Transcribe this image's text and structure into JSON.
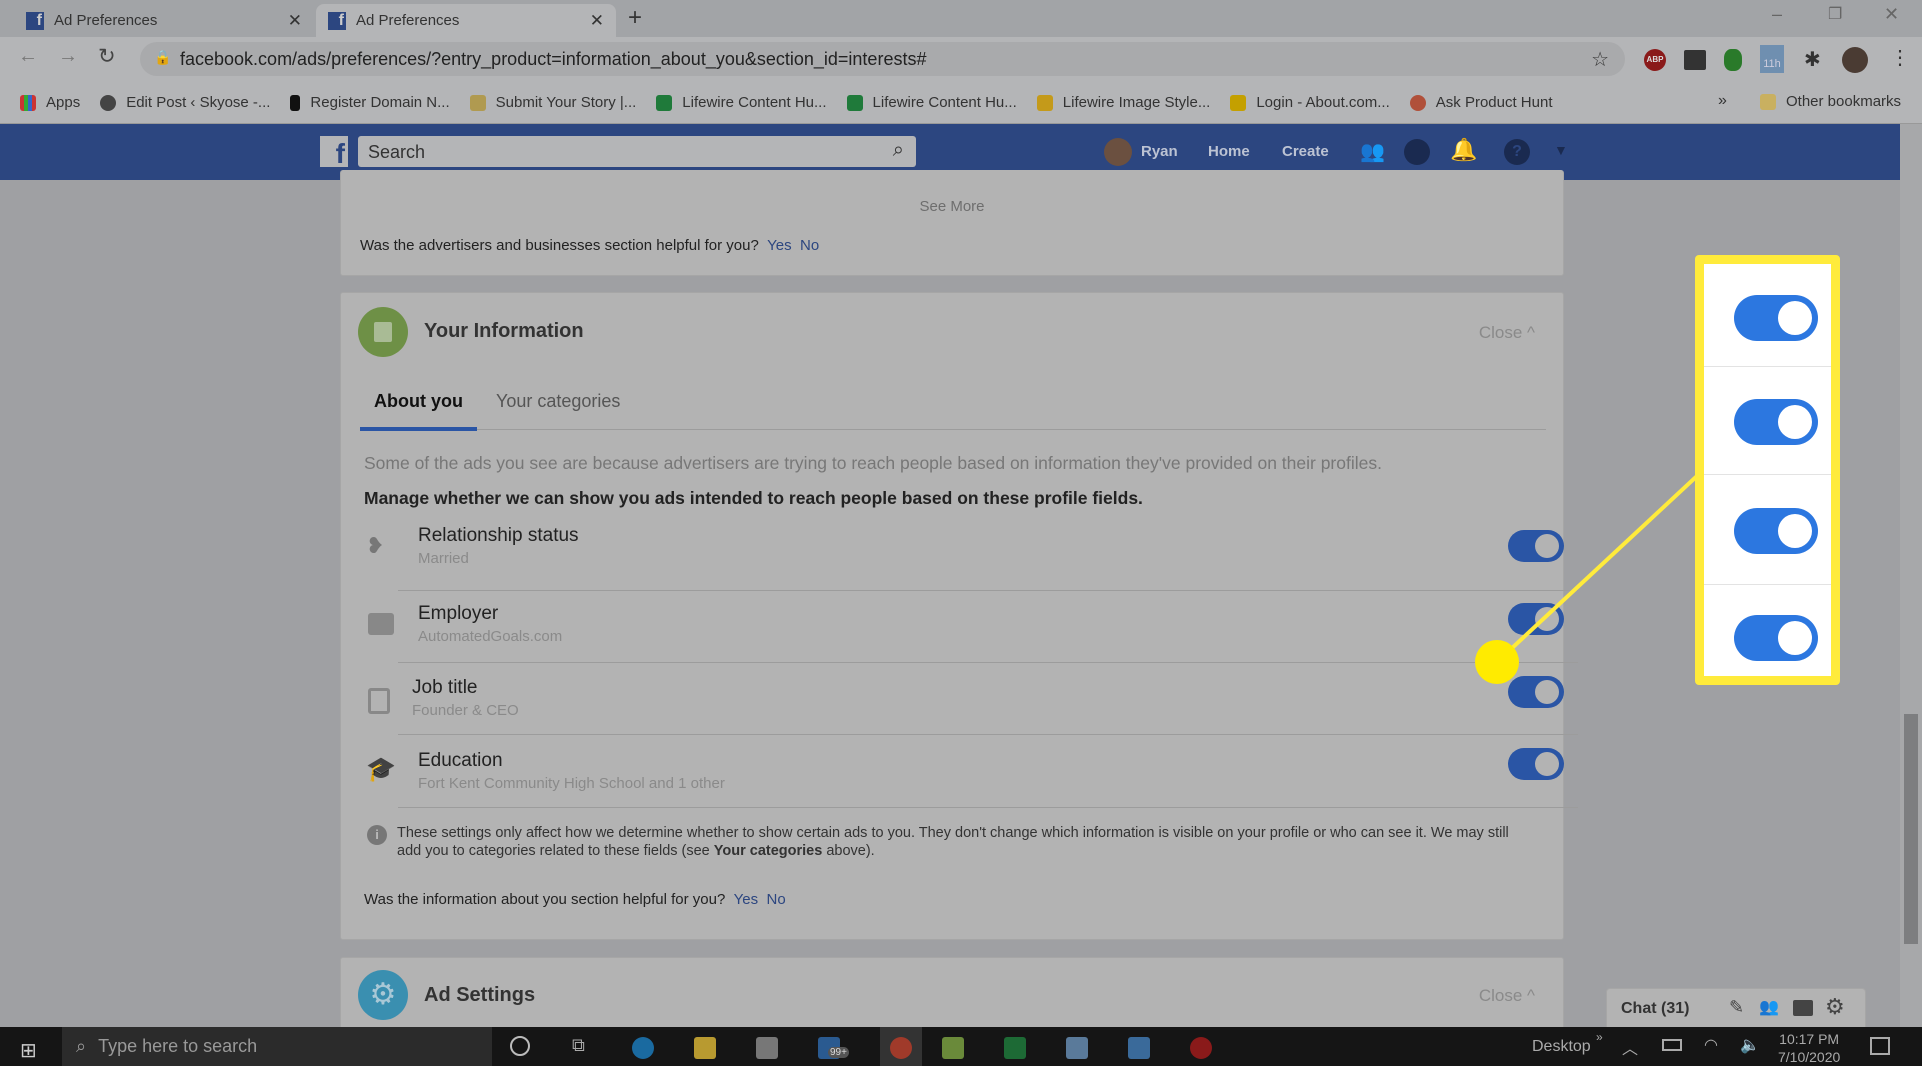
{
  "browser": {
    "tabs": [
      {
        "title": "Ad Preferences"
      },
      {
        "title": "Ad Preferences"
      }
    ],
    "url": "facebook.com/ads/preferences/?entry_product=information_about_you&section_id=interests#",
    "bookmarks": [
      "Apps",
      "Edit Post ‹ Skyose -...",
      "Register Domain N...",
      "Submit Your Story |...",
      "Lifewire Content Hu...",
      "Lifewire Content Hu...",
      "Lifewire Image Style...",
      "Login - About.com...",
      "Ask Product Hunt"
    ],
    "other_bookmarks": "Other bookmarks",
    "ext_badge": "11h"
  },
  "fb_header": {
    "search_placeholder": "Search",
    "user": "Ryan",
    "home": "Home",
    "create": "Create",
    "color": "#3b5998"
  },
  "advertisers_card": {
    "see_more": "See More",
    "question": "Was the advertisers and businesses section helpful for you?",
    "yes": "Yes",
    "no": "No"
  },
  "your_info": {
    "title": "Your Information",
    "close": "Close ^",
    "tabs": [
      {
        "label": "About you",
        "active": true
      },
      {
        "label": "Your categories",
        "active": false
      }
    ],
    "description": "Some of the ads you see are because advertisers are trying to reach people based on information they've provided on their profiles.",
    "manage": "Manage whether we can show you ads intended to reach people based on these profile fields.",
    "fields": [
      {
        "label": "Relationship status",
        "value": "Married",
        "icon": "hearts-icon",
        "enabled": true
      },
      {
        "label": "Employer",
        "value": "AutomatedGoals.com",
        "icon": "briefcase-icon",
        "enabled": true
      },
      {
        "label": "Job title",
        "value": "Founder & CEO",
        "icon": "id-badge-icon",
        "enabled": true
      },
      {
        "label": "Education",
        "value": "Fort Kent Community High School and 1 other",
        "icon": "graduation-cap-icon",
        "enabled": true
      }
    ],
    "note_a": "These settings only affect how we determine whether to show certain ads to you. They don't change which information is visible on your profile or who can see it. We may still add you to categories related to these fields (see ",
    "note_bold": "Your categories",
    "note_b": " above).",
    "question": "Was the information about you section helpful for you?",
    "yes": "Yes",
    "no": "No"
  },
  "ad_settings": {
    "title": "Ad Settings",
    "close": "Close ^"
  },
  "chat": {
    "label": "Chat (31)"
  },
  "callout": {
    "color": "#ffeb3b",
    "toggles": [
      true,
      true,
      true,
      true
    ]
  },
  "taskbar": {
    "search_placeholder": "Type here to search",
    "desktop": "Desktop",
    "time": "10:17 PM",
    "date": "7/10/2020",
    "mail_badge": "99+"
  }
}
